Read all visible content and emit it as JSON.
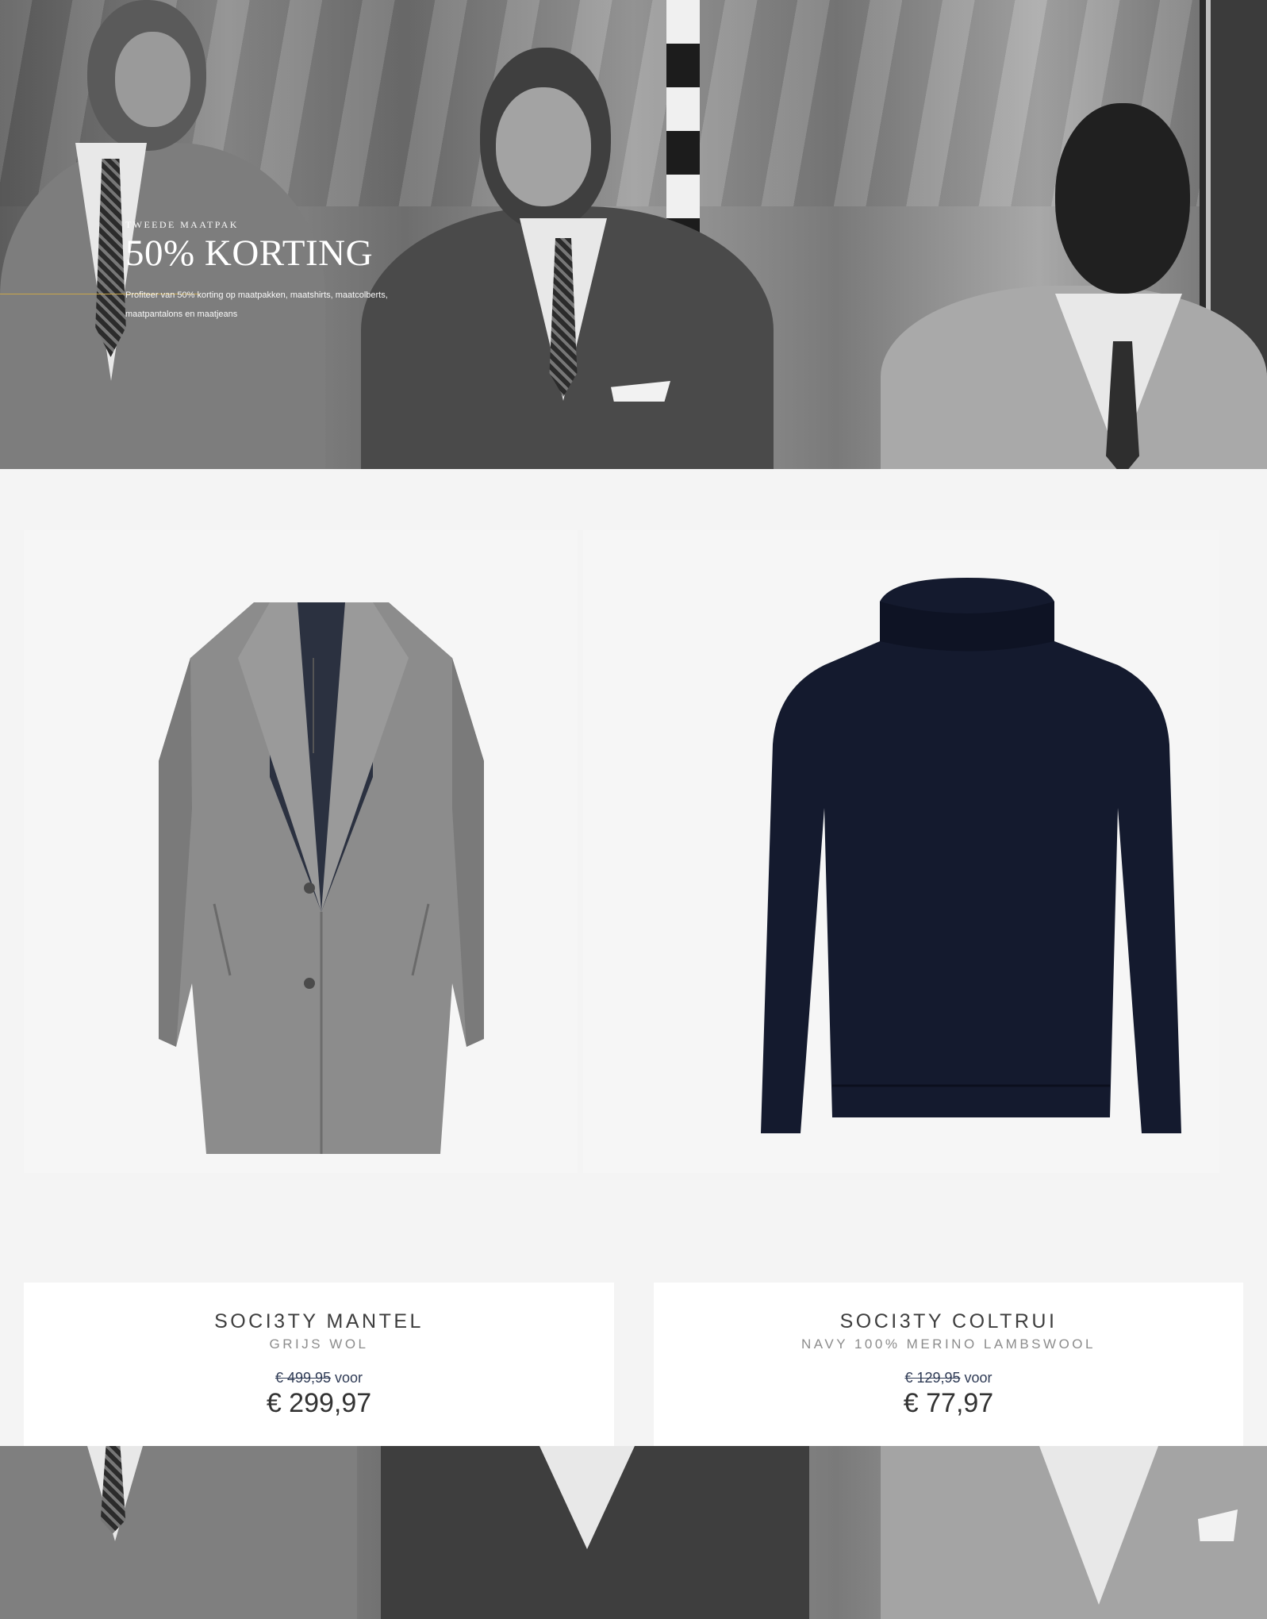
{
  "hero": {
    "eyebrow": "TWEEDE MAATPAK",
    "headline": "50% KORTING",
    "body": "Profiteer van 50% korting op maatpakken, maatshirts, maatcolberts, maatpantalons en maatjeans",
    "accent_color": "#c9a64a"
  },
  "products": [
    {
      "name": "SOCI3TY MANTEL",
      "subtitle": "GRIJS WOL",
      "old_price": "€ 499,95",
      "price_connector": "voor",
      "new_price": "€ 299,97",
      "image_icon": "grey-wool-coat"
    },
    {
      "name": "SOCI3TY COLTRUI",
      "subtitle": "NAVY 100% MERINO LAMBSWOOL",
      "old_price": "€ 129,95",
      "price_connector": "voor",
      "new_price": "€ 77,97",
      "image_icon": "navy-turtleneck-sweater"
    }
  ]
}
